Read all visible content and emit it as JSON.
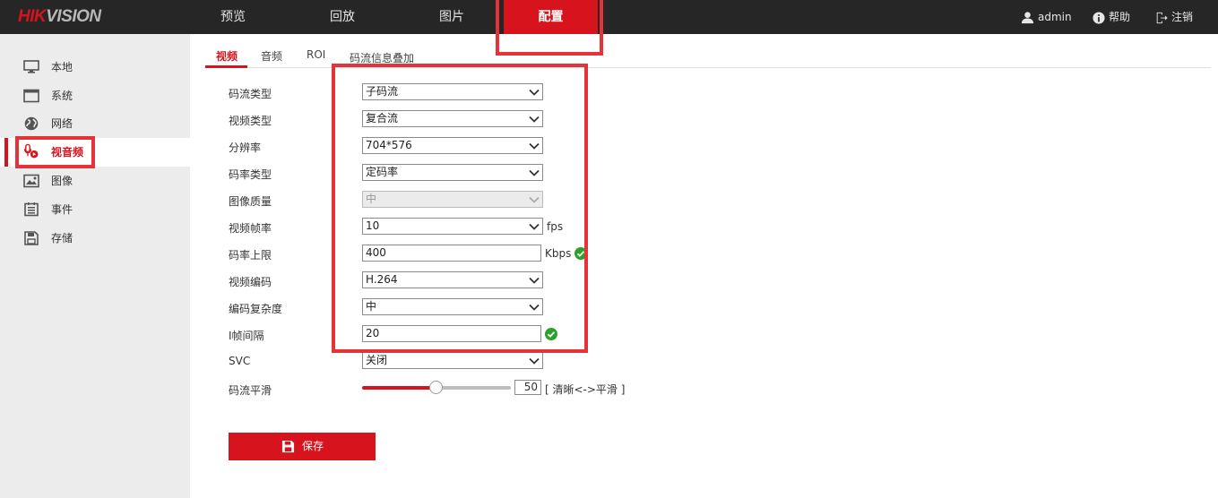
{
  "header": {
    "logo_red": "HIK",
    "logo_gray": "VISION",
    "nav": [
      "预览",
      "回放",
      "图片",
      "配置"
    ],
    "active_nav": "配置",
    "user": "admin",
    "help": "帮助",
    "logout": "注销"
  },
  "sidebar": {
    "items": [
      {
        "label": "本地",
        "icon": "monitor-icon"
      },
      {
        "label": "系统",
        "icon": "system-window-icon"
      },
      {
        "label": "网络",
        "icon": "globe-icon"
      },
      {
        "label": "视音频",
        "icon": "mic-video-icon"
      },
      {
        "label": "图像",
        "icon": "image-icon"
      },
      {
        "label": "事件",
        "icon": "event-list-icon"
      },
      {
        "label": "存储",
        "icon": "floppy-disk-icon"
      }
    ],
    "active": "视音频"
  },
  "tabs": [
    "视频",
    "音频",
    "ROI",
    "码流信息叠加"
  ],
  "active_tab": "视频",
  "form": {
    "stream_type": {
      "label": "码流类型",
      "value": "子码流"
    },
    "video_type": {
      "label": "视频类型",
      "value": "复合流"
    },
    "resolution": {
      "label": "分辨率",
      "value": "704*576"
    },
    "bitrate_type": {
      "label": "码率类型",
      "value": "定码率"
    },
    "image_quality": {
      "label": "图像质量",
      "value": "中"
    },
    "frame_rate": {
      "label": "视频帧率",
      "value": "10",
      "unit": "fps"
    },
    "max_bitrate": {
      "label": "码率上限",
      "value": "400",
      "unit": "Kbps"
    },
    "video_encoding": {
      "label": "视频编码",
      "value": "H.264"
    },
    "encoding_complexity": {
      "label": "编码复杂度",
      "value": "中"
    },
    "i_frame_interval": {
      "label": "I帧间隔",
      "value": "20"
    },
    "svc": {
      "label": "SVC",
      "value": "关闭"
    },
    "smoothing": {
      "label": "码流平滑",
      "value": "50",
      "level": 0.5,
      "note": "[ 清晰<->平滑 ]"
    }
  },
  "save_label": "保存",
  "colors": {
    "accent": "#d7131d",
    "annotation": "#e63339",
    "ok": "#2ca02c"
  }
}
